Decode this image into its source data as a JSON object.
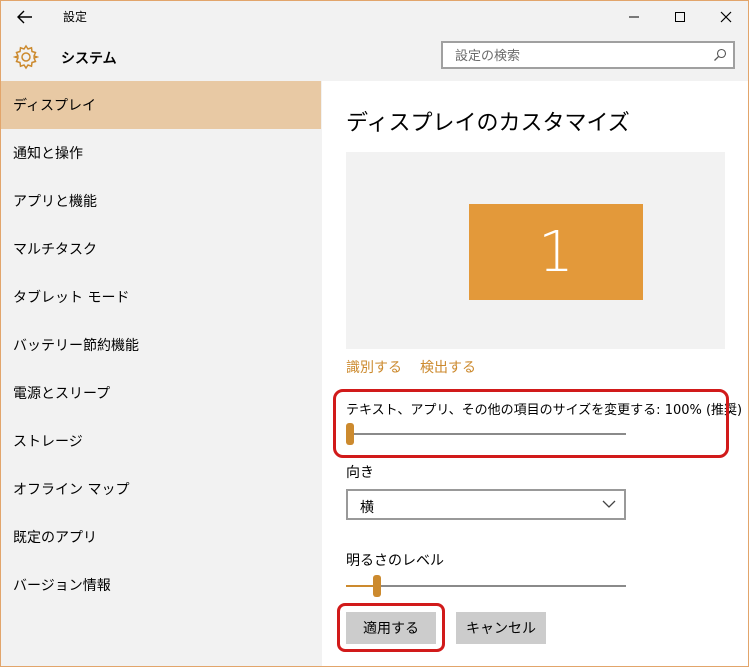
{
  "window": {
    "title": "設定"
  },
  "header": {
    "app_title": "システム",
    "search_placeholder": "設定の検索"
  },
  "sidebar": {
    "items": [
      {
        "label": "ディスプレイ",
        "active": true
      },
      {
        "label": "通知と操作"
      },
      {
        "label": "アプリと機能"
      },
      {
        "label": "マルチタスク"
      },
      {
        "label": "タブレット モード"
      },
      {
        "label": "バッテリー節約機能"
      },
      {
        "label": "電源とスリープ"
      },
      {
        "label": "ストレージ"
      },
      {
        "label": "オフライン マップ"
      },
      {
        "label": "既定のアプリ"
      },
      {
        "label": "バージョン情報"
      }
    ]
  },
  "display": {
    "title": "ディスプレイのカスタマイズ",
    "monitor_number": "1",
    "identify_label": "識別する",
    "detect_label": "検出する",
    "scale_label": "テキスト、アプリ、その他の項目のサイズを変更する: 100% (推奨)",
    "scale_slider_fraction": 0.0,
    "orientation_label": "向き",
    "orientation_value": "横",
    "brightness_label": "明るさのレベル",
    "brightness_fraction": 0.1,
    "apply_label": "適用する",
    "cancel_label": "キャンセル"
  },
  "colors": {
    "accent": "#cc8a2e",
    "monitor": "#e3993a",
    "selected_nav": "#e8c9a4",
    "annotation": "#d11a1a"
  }
}
